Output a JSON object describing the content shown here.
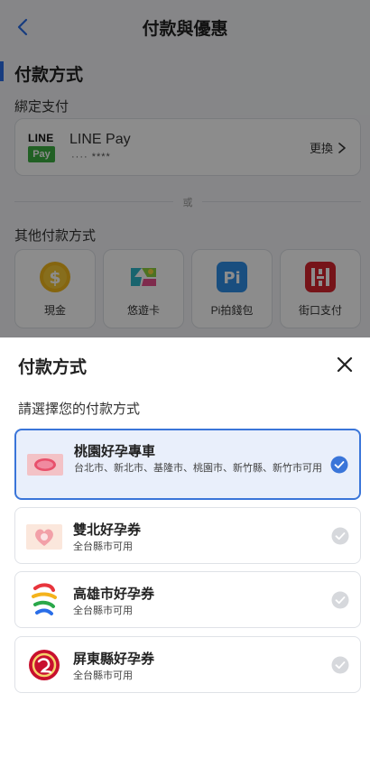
{
  "header": {
    "title": "付款與優惠"
  },
  "payment": {
    "section_title": "付款方式",
    "bound_label": "綁定支付",
    "line_pay": {
      "logo_top": "LINE",
      "logo_bottom": "Pay",
      "name": "LINE Pay",
      "masked": "···· ****",
      "change_label": "更換"
    },
    "or_label": "或",
    "other_label": "其他付款方式",
    "methods": [
      {
        "label": "現金",
        "icon": "cash-coin-icon"
      },
      {
        "label": "悠遊卡",
        "icon": "easycard-icon"
      },
      {
        "label": "Pi拍錢包",
        "icon": "pi-wallet-icon"
      },
      {
        "label": "街口支付",
        "icon": "jkopay-icon"
      }
    ]
  },
  "sheet": {
    "title": "付款方式",
    "subtitle": "請選擇您的付款方式",
    "options": [
      {
        "title": "桃園好孕專車",
        "desc": "台北市、新北市、基隆市、桃園市、新竹縣、新竹市可用",
        "selected": true,
        "icon": "taoyuan-card-icon"
      },
      {
        "title": "雙北好孕券",
        "desc": "全台縣市可用",
        "selected": false,
        "icon": "shuangbei-heart-icon"
      },
      {
        "title": "高雄市好孕券",
        "desc": "全台縣市可用",
        "selected": false,
        "icon": "kaohsiung-logo-icon"
      },
      {
        "title": "屏東縣好孕券",
        "desc": "全台縣市可用",
        "selected": false,
        "icon": "pingtung-logo-icon"
      }
    ]
  },
  "colors": {
    "accent": "#3a75d9",
    "selected_bg": "#e9effb",
    "line_green": "#3cb043"
  }
}
